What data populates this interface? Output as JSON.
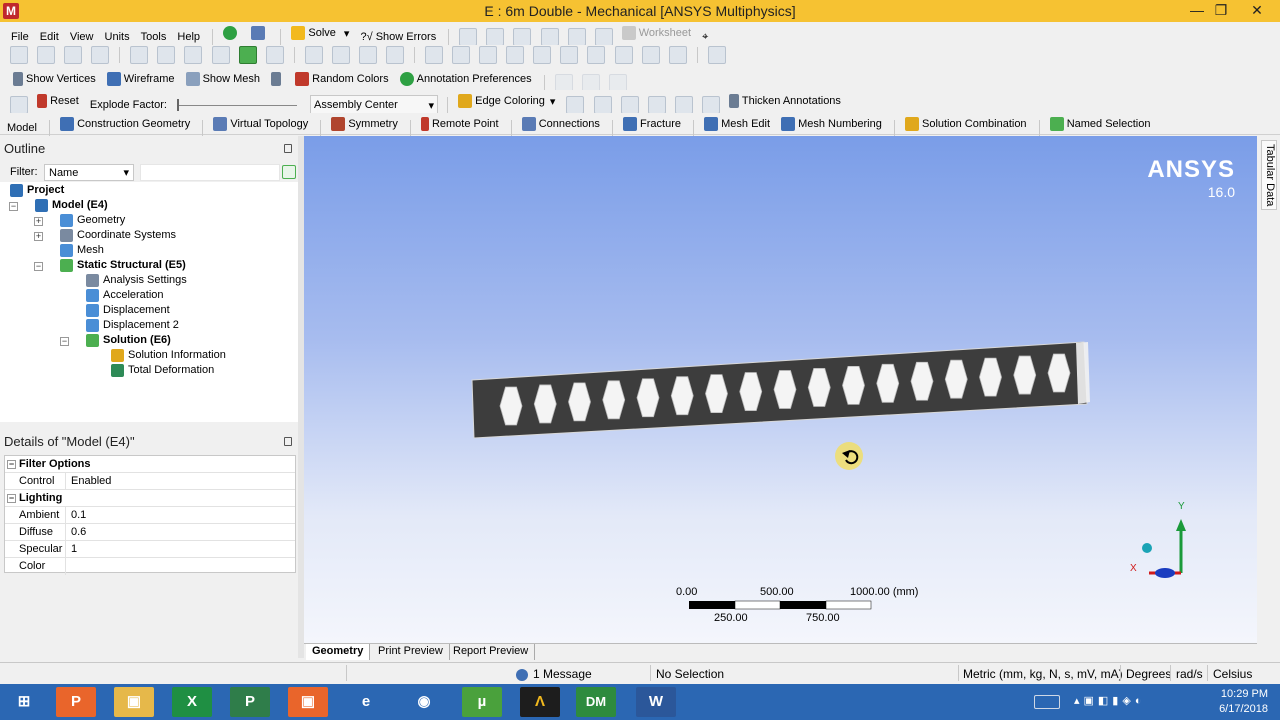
{
  "window": {
    "title": "E : 6m Double - Mechanical [ANSYS Multiphysics]",
    "app_badge": "M",
    "controls": {
      "minimize": "—",
      "restore": "❐",
      "close": "✕"
    }
  },
  "menu": [
    "File",
    "Edit",
    "View",
    "Units",
    "Tools",
    "Help"
  ],
  "toolbar1": {
    "solve": "Solve",
    "show_errors": "?√ Show Errors",
    "worksheet": "Worksheet"
  },
  "toolbar3": {
    "show_vertices": "Show Vertices",
    "wireframe": "Wireframe",
    "show_mesh": "Show Mesh",
    "random_colors": "Random Colors",
    "annotation_preferences": "Annotation Preferences"
  },
  "toolbar4": {
    "reset": "Reset",
    "explode_factor": "Explode Factor:",
    "assembly_center": "Assembly Center",
    "edge_coloring": "Edge Coloring",
    "thicken_annotations": "Thicken Annotations"
  },
  "context_toolbar": [
    "Model",
    "Construction Geometry",
    "Virtual Topology",
    "Symmetry",
    "Remote Point",
    "Connections",
    "Fracture",
    "Mesh Edit",
    "Mesh Numbering",
    "Solution Combination",
    "Named Selection"
  ],
  "outline": {
    "title": "Outline",
    "filter_label": "Filter:",
    "filter_value": "Name",
    "tree": [
      {
        "label": "Project",
        "bold": true
      },
      {
        "label": "Model (E4)",
        "bold": true
      },
      {
        "label": "Geometry",
        "bold": false
      },
      {
        "label": "Coordinate Systems",
        "bold": false
      },
      {
        "label": "Mesh",
        "bold": false
      },
      {
        "label": "Static Structural (E5)",
        "bold": true
      },
      {
        "label": "Analysis Settings",
        "bold": false
      },
      {
        "label": "Acceleration",
        "bold": false
      },
      {
        "label": "Displacement",
        "bold": false
      },
      {
        "label": "Displacement 2",
        "bold": false
      },
      {
        "label": "Solution (E6)",
        "bold": true
      },
      {
        "label": "Solution Information",
        "bold": false
      },
      {
        "label": "Total Deformation",
        "bold": false
      }
    ]
  },
  "details": {
    "title": "Details of \"Model (E4)\"",
    "groups": {
      "filter_options": "Filter Options",
      "lighting": "Lighting"
    },
    "rows": {
      "control": {
        "k": "Control",
        "v": "Enabled"
      },
      "ambient": {
        "k": "Ambient",
        "v": "0.1"
      },
      "diffuse": {
        "k": "Diffuse",
        "v": "0.6"
      },
      "specular": {
        "k": "Specular",
        "v": "1"
      },
      "color": {
        "k": "Color",
        "v": ""
      }
    }
  },
  "viewport": {
    "brand": "ANSYS",
    "version": "16.0",
    "scale": {
      "top_labels": [
        "0.00",
        "500.00",
        "1000.00 (mm)"
      ],
      "bottom_labels": [
        "250.00",
        "750.00"
      ]
    },
    "triad": {
      "y": "Y",
      "x": "X"
    }
  },
  "right_strip": {
    "tabular_data": "Tabular Data"
  },
  "view_tabs": [
    "Geometry",
    "Print Preview",
    "Report Preview"
  ],
  "status": {
    "messages": "1 Message",
    "selection": "No Selection",
    "units": "Metric (mm, kg, N, s, mV, mA)",
    "angle": "Degrees",
    "rot": "rad/s",
    "temp": "Celsius"
  },
  "taskbar": {
    "time": "10:29 PM",
    "date": "6/17/2018",
    "apps": [
      "⊞",
      "P",
      "▣",
      "X",
      "P",
      "▣",
      "e",
      "◉",
      "µ",
      "Λ",
      "DM",
      "W"
    ]
  },
  "colors": {
    "titlebar": "#f6c232",
    "taskbar": "#2b67b3",
    "beam": "#3d3d3d",
    "green_check": "#2ea043",
    "tree_blue": "#2f6fb5"
  }
}
